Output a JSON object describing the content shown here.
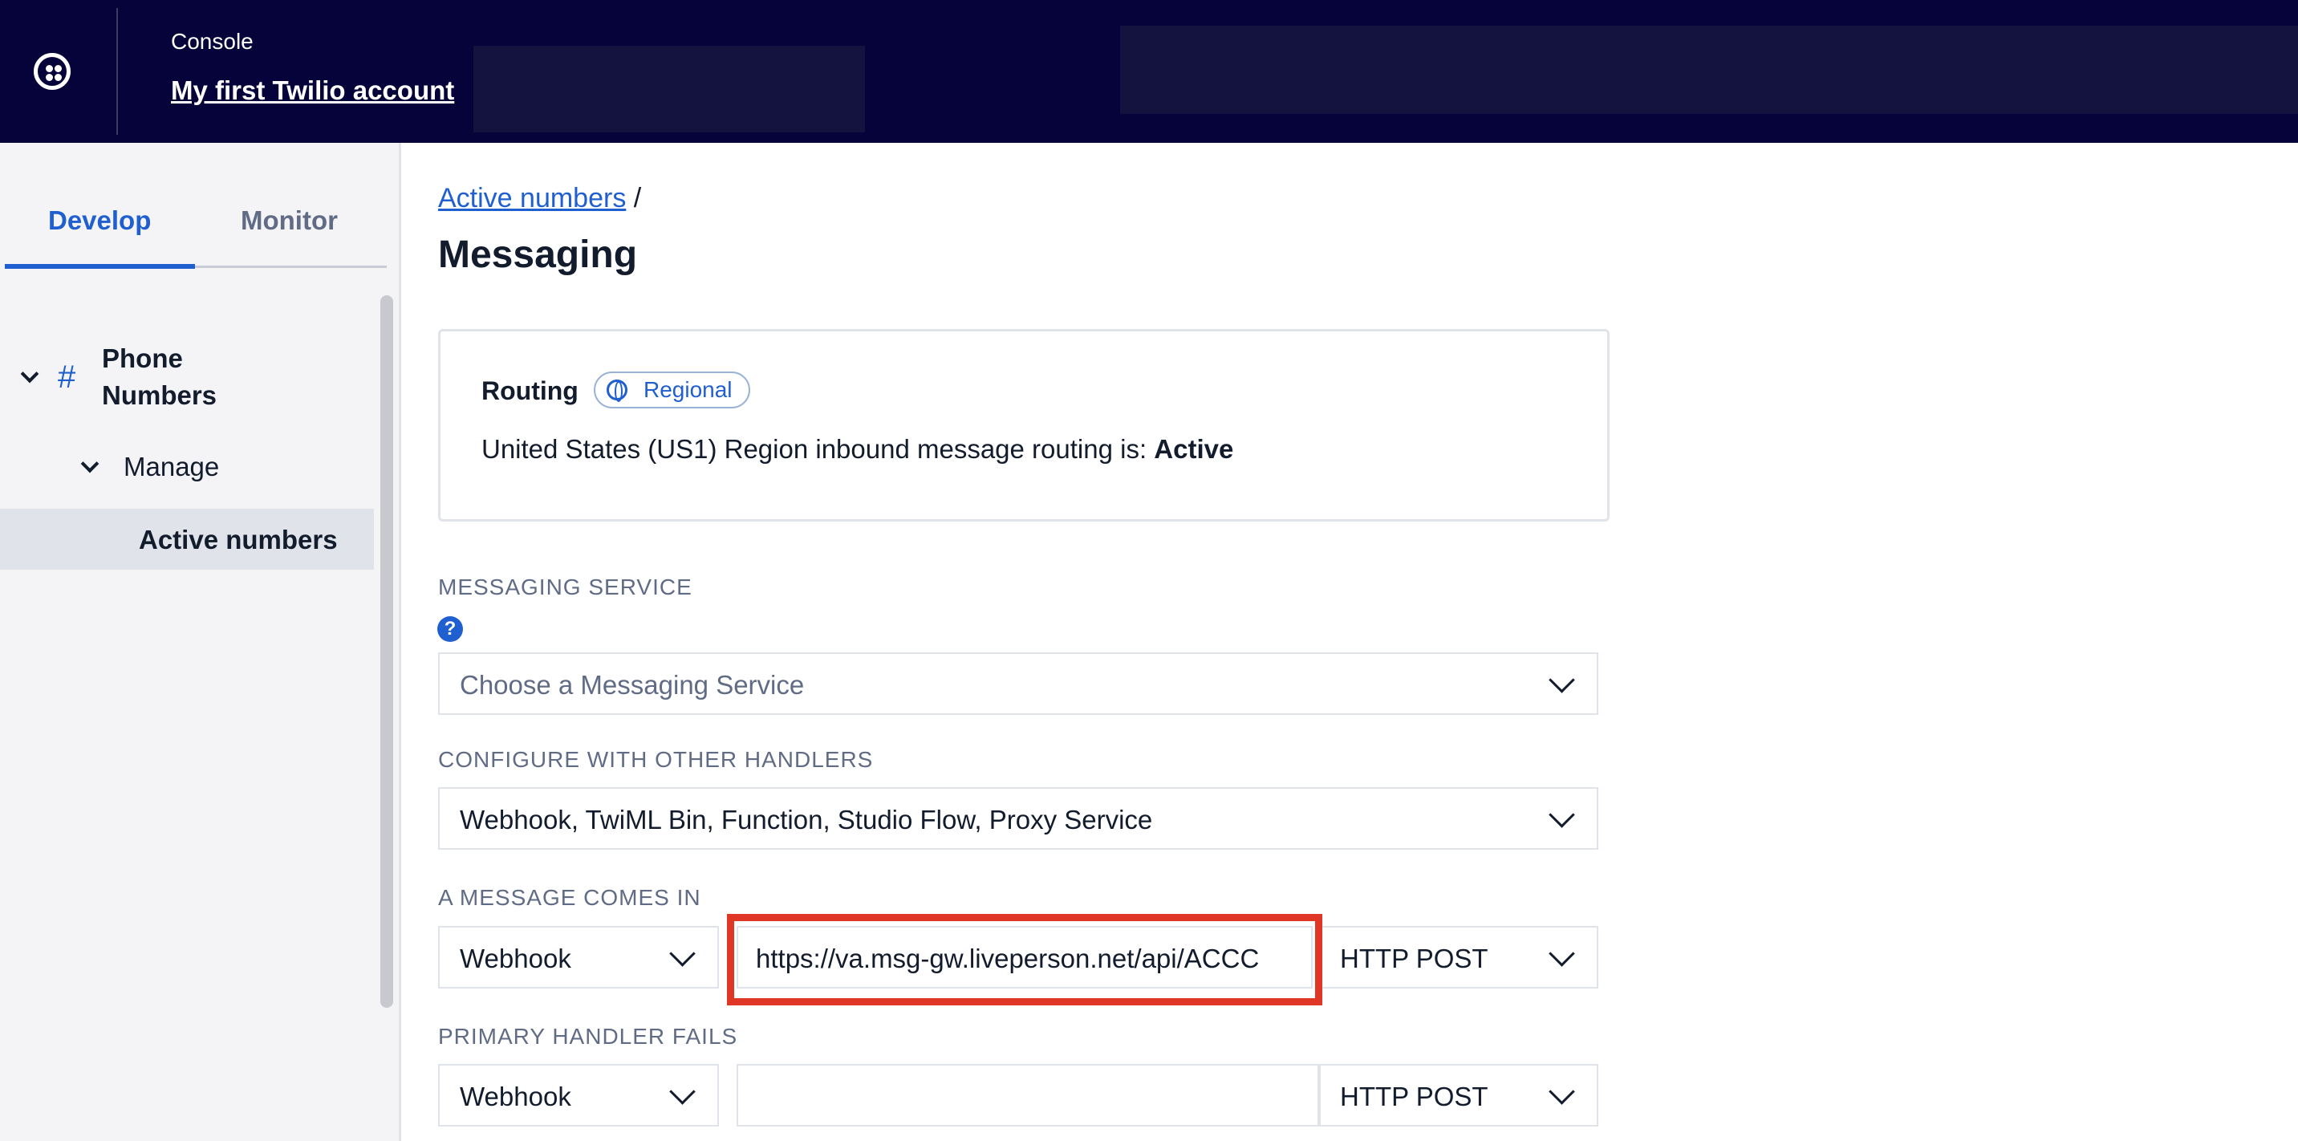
{
  "header": {
    "console_label": "Console",
    "account_name": "My first Twilio account"
  },
  "sidebar": {
    "tabs": [
      {
        "label": "Develop",
        "active": true
      },
      {
        "label": "Monitor",
        "active": false
      }
    ],
    "nav": {
      "phone_numbers": "Phone Numbers",
      "manage": "Manage",
      "active_numbers": "Active numbers"
    }
  },
  "main": {
    "breadcrumb": {
      "link": "Active numbers",
      "separator": "/"
    },
    "title": "Messaging",
    "routing": {
      "label": "Routing",
      "badge": "Regional",
      "text": "United States (US1) Region inbound message routing is:",
      "status": "Active"
    },
    "messaging_service": {
      "label": "MESSAGING SERVICE",
      "help": "?",
      "placeholder": "Choose a Messaging Service"
    },
    "other_handlers": {
      "label": "CONFIGURE WITH OTHER HANDLERS",
      "value": "Webhook, TwiML Bin, Function, Studio Flow, Proxy Service"
    },
    "message_comes_in": {
      "label": "A MESSAGE COMES IN",
      "type": "Webhook",
      "url": "https://va.msg-gw.liveperson.net/api/ACCC",
      "method": "HTTP POST"
    },
    "primary_handler_fails": {
      "label": "PRIMARY HANDLER FAILS",
      "type": "Webhook",
      "url": "",
      "method": "HTTP POST"
    }
  },
  "colors": {
    "topbar": "#06033a",
    "accent": "#1f5fd0",
    "highlight": "#e03626"
  }
}
